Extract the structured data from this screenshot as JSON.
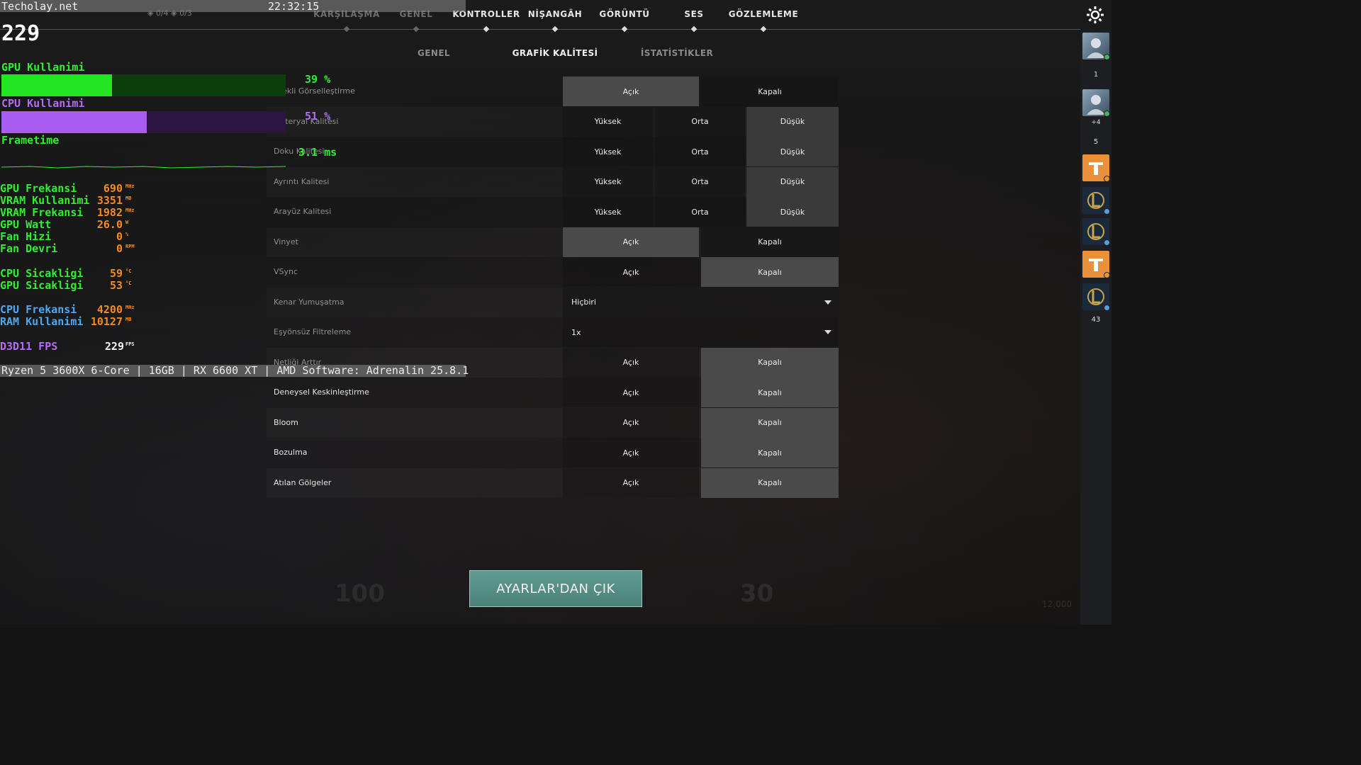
{
  "nav": {
    "tabs": [
      {
        "label": "KARŞILAŞMA",
        "dim": true
      },
      {
        "label": "GENEL",
        "dim": true
      },
      {
        "label": "KONTROLLER",
        "dim": false
      },
      {
        "label": "NİŞANGÂH",
        "dim": false
      },
      {
        "label": "GÖRÜNTÜ",
        "dim": false
      },
      {
        "label": "SES",
        "dim": false
      },
      {
        "label": "GÖZLEMLEME",
        "dim": false
      }
    ],
    "settings_icon": "gear-icon"
  },
  "subtabs": [
    {
      "label": "GENEL",
      "active": false
    },
    {
      "label": "GRAFİK KALİTESİ",
      "active": true
    },
    {
      "label": "İSTATİSTİKLER",
      "active": false
    }
  ],
  "settings": [
    {
      "label": "İzlekli Görselleştirme",
      "type": "toggle",
      "options": [
        "Açık",
        "Kapalı"
      ],
      "selected": 0
    },
    {
      "label": "Materyal Kalitesi",
      "type": "triple",
      "options": [
        "Yüksek",
        "Orta",
        "Düşük"
      ],
      "selected": 2
    },
    {
      "label": "Doku Kalitesi",
      "type": "triple",
      "options": [
        "Yüksek",
        "Orta",
        "Düşük"
      ],
      "selected": 2
    },
    {
      "label": "Ayrıntı Kalitesi",
      "type": "triple",
      "options": [
        "Yüksek",
        "Orta",
        "Düşük"
      ],
      "selected": 2
    },
    {
      "label": "Arayüz Kalitesi",
      "type": "triple",
      "options": [
        "Yüksek",
        "Orta",
        "Düşük"
      ],
      "selected": 2
    },
    {
      "label": "Vinyet",
      "type": "toggle",
      "options": [
        "Açık",
        "Kapalı"
      ],
      "selected": 0
    },
    {
      "label": "VSync",
      "type": "toggle",
      "options": [
        "Açık",
        "Kapalı"
      ],
      "selected": 1
    },
    {
      "label": "Kenar Yumuşatma",
      "type": "dropdown",
      "value": "Hiçbiri"
    },
    {
      "label": "Eşyönsüz Filtreleme",
      "type": "dropdown",
      "value": "1x"
    },
    {
      "label": "Netliği Arttır",
      "type": "toggle",
      "options": [
        "Açık",
        "Kapalı"
      ],
      "selected": 1
    },
    {
      "label": "Deneysel Keskinleştirme",
      "type": "toggle",
      "options": [
        "Açık",
        "Kapalı"
      ],
      "selected": 1,
      "bright": true
    },
    {
      "label": "Bloom",
      "type": "toggle",
      "options": [
        "Açık",
        "Kapalı"
      ],
      "selected": 1,
      "bright": true
    },
    {
      "label": "Bozulma",
      "type": "toggle",
      "options": [
        "Açık",
        "Kapalı"
      ],
      "selected": 1,
      "bright": true
    },
    {
      "label": "Atılan Gölgeler",
      "type": "toggle",
      "options": [
        "Açık",
        "Kapalı"
      ],
      "selected": 1,
      "bright": true
    }
  ],
  "exit_button": "AYARLAR'DAN ÇIK",
  "hud": {
    "left_num": "100",
    "right_num": "30",
    "right_small": "12,000"
  },
  "sidebar": {
    "items": [
      {
        "kind": "avatar",
        "icon": "agent-avatar-icon",
        "num": "1",
        "dot": "green"
      },
      {
        "kind": "avatar",
        "icon": "agent-avatar-icon",
        "num": "",
        "dot": "green",
        "party": "+4"
      },
      {
        "kind": "num",
        "num": "5"
      },
      {
        "kind": "logo",
        "icon": "tft-logo-icon",
        "color": "#e8913a",
        "dot": "orange"
      },
      {
        "kind": "logo",
        "icon": "lol-logo-icon",
        "color": "#1b2a3a",
        "dot": "blue"
      },
      {
        "kind": "logo",
        "icon": "lol-logo-icon",
        "color": "#1b2a3a",
        "dot": "blue"
      },
      {
        "kind": "logo",
        "icon": "tft-logo-icon",
        "color": "#e8913a",
        "dot": "orange"
      },
      {
        "kind": "logo",
        "icon": "lol-logo-icon",
        "color": "#1b2a3a",
        "dot": "blue"
      },
      {
        "kind": "num",
        "num": "43"
      }
    ]
  },
  "overlay": {
    "site": "Techolay.net",
    "time": "22:32:15",
    "counts": "◈ 0/4  ◈ 0/3",
    "fps_big": "229",
    "gpu_label": "GPU Kullanimi",
    "gpu_pct": "39 %",
    "gpu_value": 0.39,
    "cpu_label": "CPU Kullanimi",
    "cpu_pct": "51 %",
    "cpu_value": 0.51,
    "frametime_label": "Frametime",
    "frametime_value": "3.1 ms",
    "stats_group1": [
      {
        "name": "GPU Frekansi",
        "value": "690",
        "unit": "MHz"
      },
      {
        "name": "VRAM Kullanimi",
        "value": "3351",
        "unit": "MB"
      },
      {
        "name": "VRAM Frekansi",
        "value": "1982",
        "unit": "MHz"
      },
      {
        "name": "GPU Watt",
        "value": "26.0",
        "unit": "W"
      },
      {
        "name": "Fan Hizi",
        "value": "0",
        "unit": "%"
      },
      {
        "name": "Fan Devri",
        "value": "0",
        "unit": "RPM"
      }
    ],
    "stats_group2": [
      {
        "name": "CPU Sicakligi",
        "value": "59",
        "unit": "°C"
      },
      {
        "name": "GPU Sicakligi",
        "value": "53",
        "unit": "°C"
      }
    ],
    "stats_group3": [
      {
        "name": "CPU Frekansi",
        "value": "4200",
        "unit": "MHz"
      },
      {
        "name": "RAM Kullanimi",
        "value": "10127",
        "unit": "MB"
      }
    ],
    "d3d_label": "D3D11 FPS",
    "d3d_value": "229",
    "d3d_unit": "FPS",
    "footer": "Ryzen 5 3600X 6-Core | 16GB | RX 6600 XT | AMD Software: Adrenalin 25.8.1"
  }
}
